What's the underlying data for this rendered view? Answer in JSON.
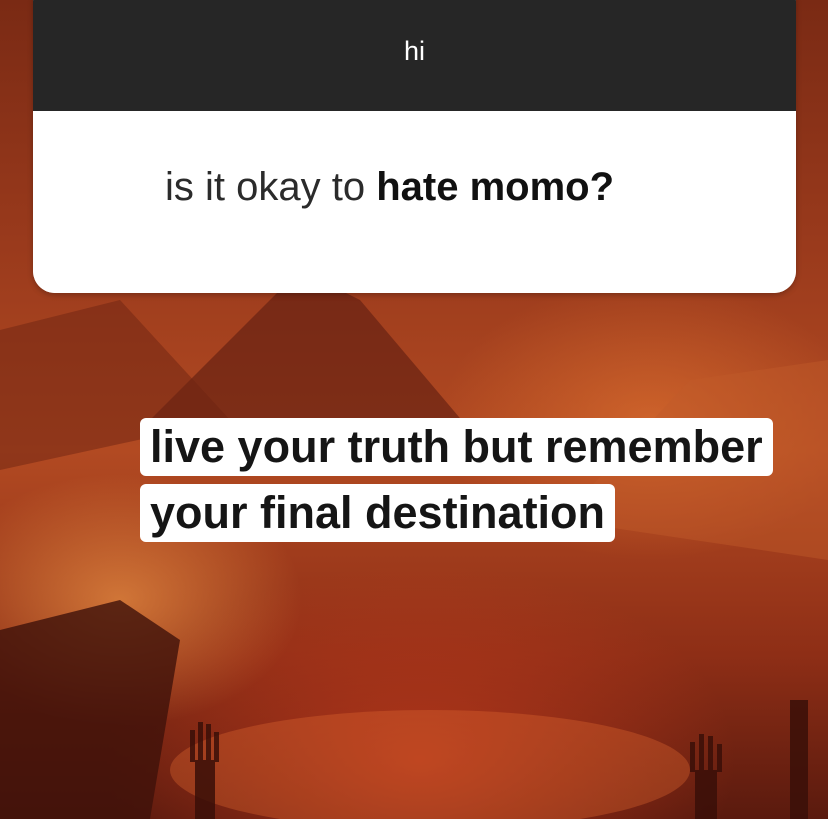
{
  "story": {
    "question_sticker": {
      "header": "hi",
      "question_plain": "is it okay to ",
      "question_bold": "hate momo?"
    },
    "caption": {
      "line1": "live your truth but remember",
      "line2": "your final destination"
    }
  },
  "colors": {
    "sticker_header": "#262626",
    "sticker_body": "#ffffff",
    "background": "#9a3a1c"
  }
}
